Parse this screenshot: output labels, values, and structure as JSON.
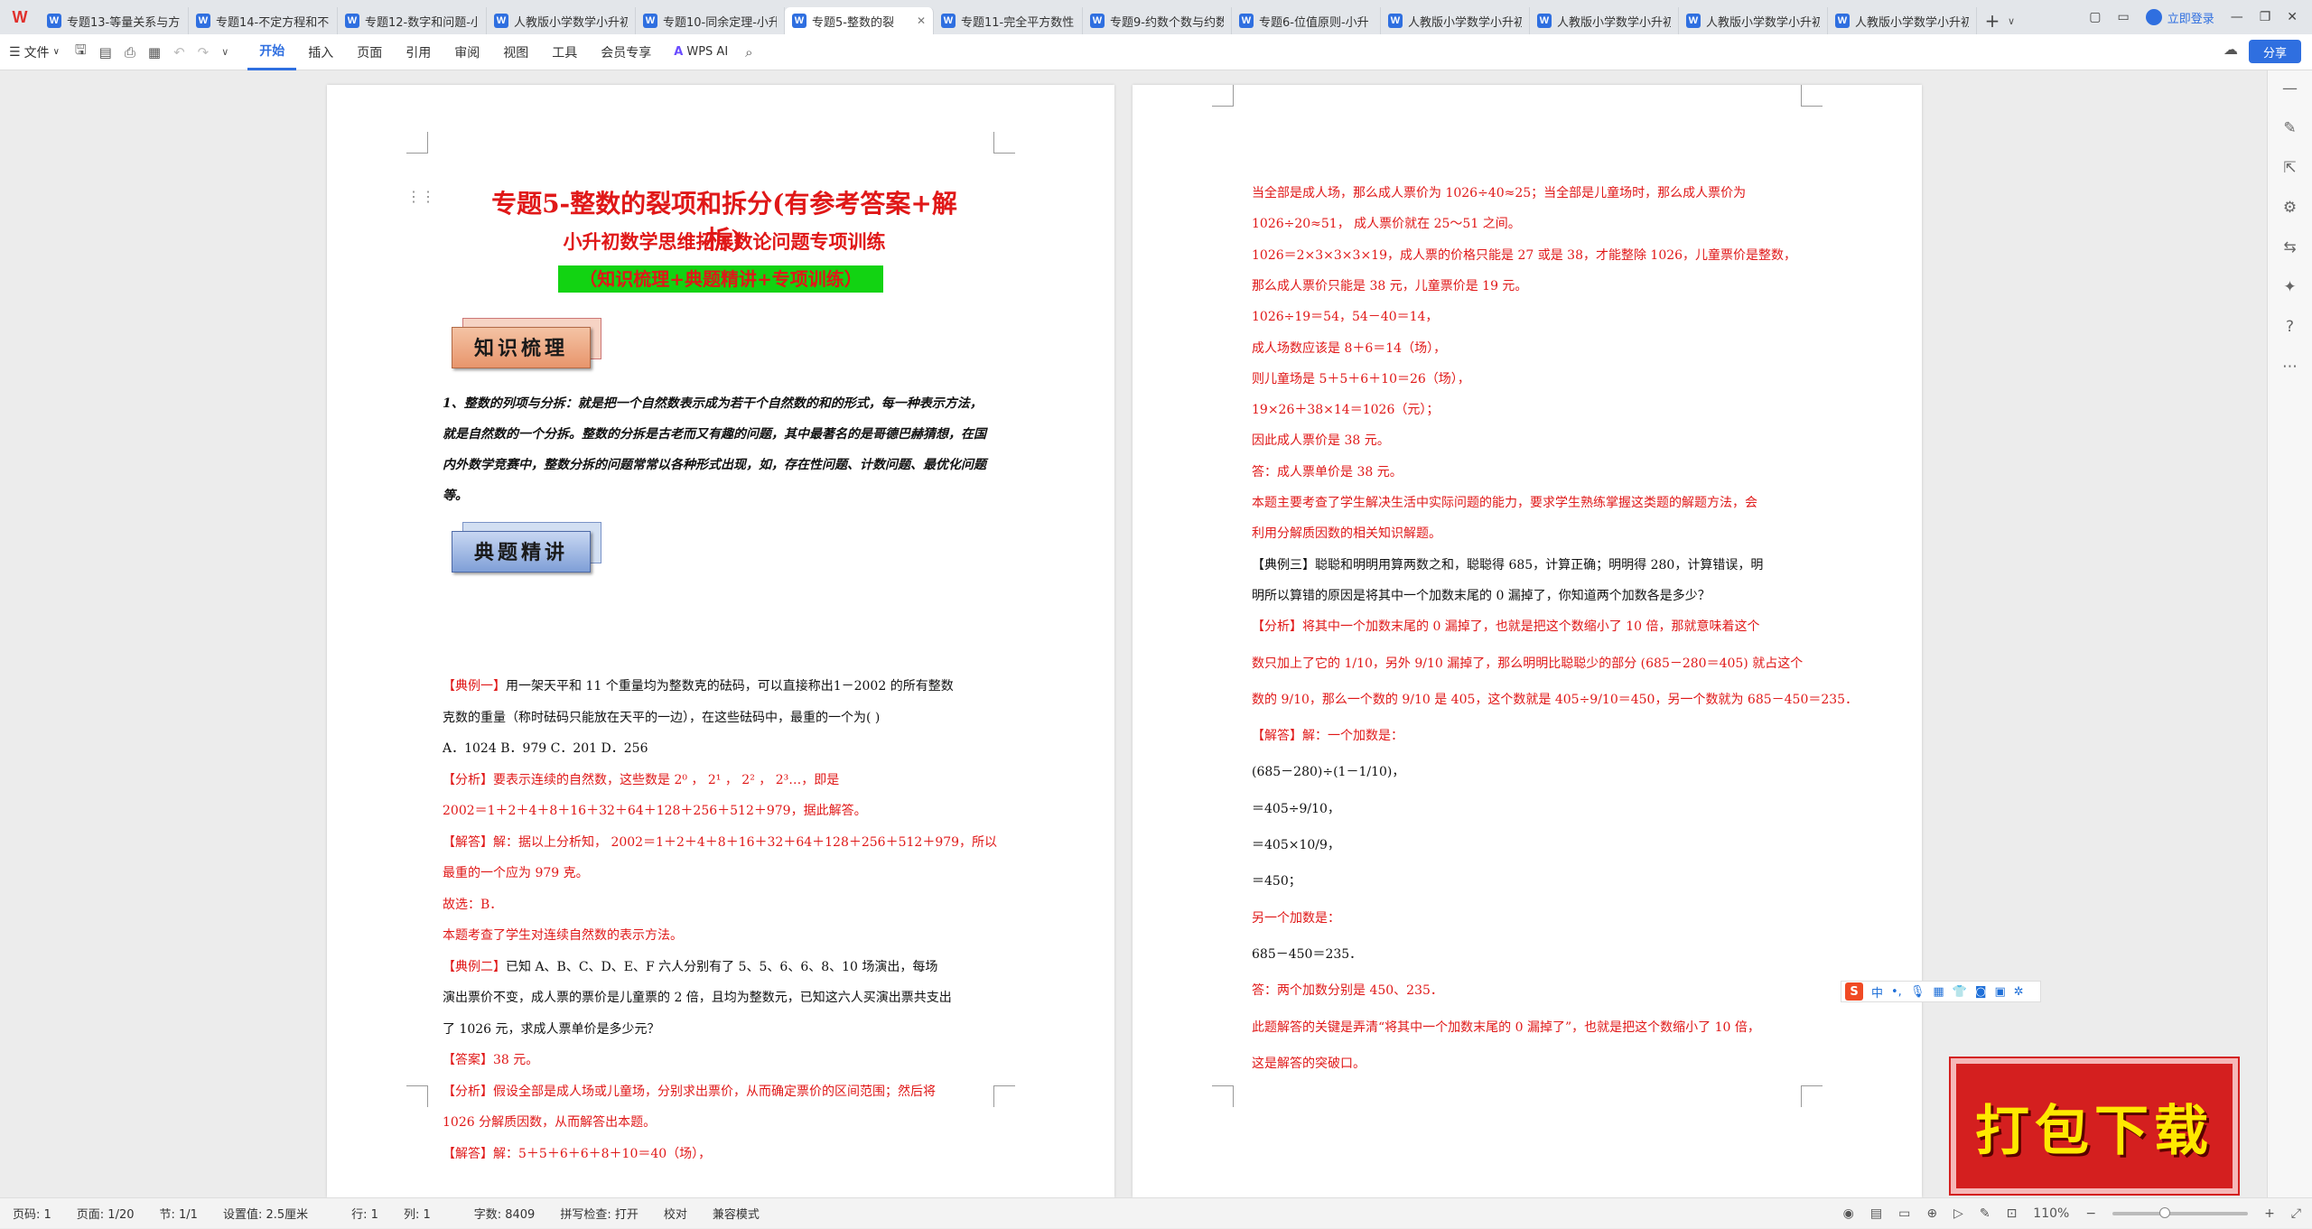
{
  "app": {
    "logo": "W"
  },
  "tabs": [
    {
      "label": "专题13-等量关系与方",
      "active": false
    },
    {
      "label": "专题14-不定方程和不",
      "active": false
    },
    {
      "label": "专题12-数字和问题-小",
      "active": false
    },
    {
      "label": "人教版小学数学小升初",
      "active": false
    },
    {
      "label": "专题10-同余定理-小升",
      "active": false
    },
    {
      "label": "专题5-整数的裂",
      "active": true
    },
    {
      "label": "专题11-完全平方数性",
      "active": false
    },
    {
      "label": "专题9-约数个数与约数",
      "active": false
    },
    {
      "label": "专题6-位值原则-小升",
      "active": false
    },
    {
      "label": "人教版小学数学小升初",
      "active": false
    },
    {
      "label": "人教版小学数学小升初",
      "active": false
    },
    {
      "label": "人教版小学数学小升初",
      "active": false
    },
    {
      "label": "人教版小学数学小升初",
      "active": false
    }
  ],
  "window": {
    "login": "立即登录",
    "share": "分享"
  },
  "toolbar": {
    "file_menu": "文件",
    "ribbon_tabs": [
      "开始",
      "插入",
      "页面",
      "引用",
      "审阅",
      "视图",
      "工具",
      "会员专享"
    ],
    "active_tab": "开始",
    "wps_ai": "WPS AI"
  },
  "page1": {
    "title": "专题5-整数的裂项和拆分(有参考答案+解析)",
    "subtitle": "小升初数学思维拓展数论问题专项训练",
    "tagline": "（知识梳理+典题精讲+专项训练）",
    "banner1": "知识梳理",
    "banner2": "典题精讲",
    "knowledge": "1、整数的列项与分拆：就是把一个自然数表示成为若干个自然数的和的形式，每一种表示方法，就是自然数的一个分拆。整数的分拆是古老而又有趣的问题，其中最著名的是哥德巴赫猜想，在国内外数学竞赛中，整数分拆的问题常常以各种形式出现，如，存在性问题、计数问题、最优化问题等。",
    "lines": [
      {
        "prefix": "【典例一】",
        "text": "用一架天平和 11 个重量均为整数克的砝码，可以直接称出1－2002 的所有整数",
        "color": "black"
      },
      {
        "prefix": "",
        "text": "克数的重量（称时砝码只能放在天平的一边），在这些砝码中，最重的一个为(      )",
        "color": "black"
      },
      {
        "prefix": "",
        "text": "A．1024                    B．979                     C．201                     D．256",
        "color": "black"
      },
      {
        "prefix": "【分析】",
        "text": "要表示连续的自然数，这些数是 2⁰ ， 2¹ ， 2² ， 2³…，即是",
        "color": "red"
      },
      {
        "prefix": "",
        "text": "2002＝1＋2＋4＋8＋16＋32＋64＋128＋256＋512＋979，据此解答。",
        "color": "red"
      },
      {
        "prefix": "【解答】",
        "text": "解：据以上分析知， 2002＝1＋2＋4＋8＋16＋32＋64＋128＋256＋512＋979，所以",
        "color": "red"
      },
      {
        "prefix": "",
        "text": "最重的一个应为 979 克。",
        "color": "red"
      },
      {
        "prefix": "",
        "text": "故选：B．",
        "color": "red"
      },
      {
        "prefix": "",
        "text": "本题考查了学生对连续自然数的表示方法。",
        "color": "red"
      },
      {
        "prefix": "【典例二】",
        "text": "已知 A、B、C、D、E、F 六人分别有了 5、5、6、6、8、10 场演出，每场",
        "color": "black"
      },
      {
        "prefix": "",
        "text": "演出票价不变，成人票的票价是儿童票的 2 倍，且均为整数元，已知这六人买演出票共支出",
        "color": "black"
      },
      {
        "prefix": "",
        "text": "了 1026 元，求成人票单价是多少元？",
        "color": "black"
      },
      {
        "prefix": "【答案】",
        "text": "38 元。",
        "color": "red"
      },
      {
        "prefix": "【分析】",
        "text": "假设全部是成人场或儿童场，分别求出票价，从而确定票价的区间范围；然后将",
        "color": "red"
      },
      {
        "prefix": "",
        "text": "1026 分解质因数，从而解答出本题。",
        "color": "red"
      },
      {
        "prefix": "【解答】",
        "text": "解：5＋5＋6＋6＋8＋10＝40（场），",
        "color": "red"
      }
    ]
  },
  "page2": {
    "lines": [
      {
        "text": "当全部是成人场，那么成人票价为 1026÷40≈25；当全部是儿童场时，那么成人票价为",
        "color": "red"
      },
      {
        "text": "1026÷20≈51， 成人票价就在 25～51 之间。",
        "color": "red"
      },
      {
        "text": "1026＝2×3×3×3×19，成人票的价格只能是 27 或是 38，才能整除 1026，儿童票价是整数，",
        "color": "red"
      },
      {
        "text": "那么成人票价只能是 38 元，儿童票价是 19 元。",
        "color": "red"
      },
      {
        "text": "1026÷19＝54，54－40＝14，",
        "color": "red"
      },
      {
        "text": "成人场数应该是 8＋6＝14（场），",
        "color": "red"
      },
      {
        "text": "则儿童场是 5＋5＋6＋10＝26（场），",
        "color": "red"
      },
      {
        "text": "19×26＋38×14＝1026（元）；",
        "color": "red"
      },
      {
        "text": "因此成人票价是 38 元。",
        "color": "red"
      },
      {
        "text": "答：成人票单价是 38 元。",
        "color": "red"
      },
      {
        "text": "本题主要考查了学生解决生活中实际问题的能力，要求学生熟练掌握这类题的解题方法，会",
        "color": "red"
      },
      {
        "text": "利用分解质因数的相关知识解题。",
        "color": "red"
      },
      {
        "text": "【典例三】聪聪和明明用算两数之和，聪聪得 685，计算正确；明明得 280，计算错误，明",
        "color": "black"
      },
      {
        "text": "明所以算错的原因是将其中一个加数末尾的 0 漏掉了，你知道两个加数各是多少？",
        "color": "black"
      },
      {
        "text": "【分析】将其中一个加数末尾的 0 漏掉了，也就是把这个数缩小了 10 倍，那就意味着这个",
        "color": "red"
      },
      {
        "text": "数只加上了它的 1/10，另外 9/10 漏掉了，那么明明比聪聪少的部分 (685－280＝405) 就占这个",
        "color": "red"
      },
      {
        "text": "数的 9/10，那么一个数的 9/10 是 405，这个数就是 405÷9/10＝450，另一个数就为 685－450＝235．",
        "color": "red"
      },
      {
        "text": "【解答】解：一个加数是：",
        "color": "red"
      },
      {
        "text": "(685－280)÷(1－1/10)，",
        "color": "black"
      },
      {
        "text": "＝405÷9/10，",
        "color": "black"
      },
      {
        "text": "＝405×10/9，",
        "color": "black"
      },
      {
        "text": "＝450；",
        "color": "black"
      },
      {
        "text": "另一个加数是：",
        "color": "red"
      },
      {
        "text": "685－450＝235．",
        "color": "black"
      },
      {
        "text": "答：两个加数分别是 450、235．",
        "color": "red"
      },
      {
        "text": "此题解答的关键是弄清“将其中一个加数末尾的 0 漏掉了”，也就是把这个数缩小了 10 倍，",
        "color": "red"
      },
      {
        "text": "这是解答的突破口。",
        "color": "red"
      }
    ]
  },
  "status": {
    "page_code": "页码: 1",
    "pages": "页面: 1/20",
    "section": "节: 1/1",
    "setting": "设置值: 2.5厘米",
    "row": "行: 1",
    "col": "列: 1",
    "words": "字数: 8409",
    "spell": "拼写检查: 打开",
    "proof": "校对",
    "compat": "兼容模式",
    "zoom": "110%"
  },
  "ime": {
    "label": "中"
  },
  "download_badge": "打包下载",
  "colors": {
    "accent": "#2f6fe0",
    "red_text": "#e01818",
    "green_box": "#12d312"
  }
}
